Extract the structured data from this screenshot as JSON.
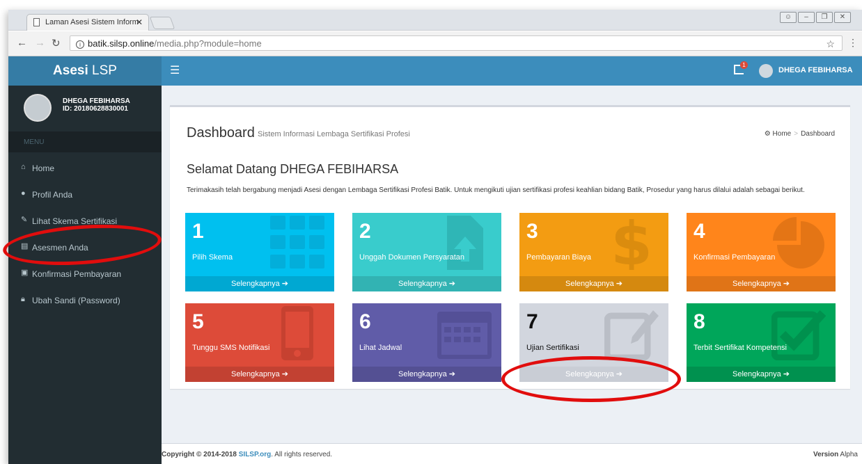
{
  "browser": {
    "tab_title": "Laman Asesi Sistem Inform",
    "url_host": "batik.silsp.online",
    "url_path": "/media.php?module=home"
  },
  "app": {
    "logo_bold": "Asesi",
    "logo_rest": " LSP",
    "notif_count": "1",
    "top_user": "DHEGA FEBIHARSA"
  },
  "sidebar": {
    "user_name": "DHEGA FEBIHARSA",
    "user_id": "ID: 20180628830001",
    "menu_header": "MENU",
    "items": [
      {
        "label": "Home",
        "icon": "home-icon"
      },
      {
        "label": "Profil Anda",
        "icon": "user-icon"
      },
      {
        "label": "Lihat Skema Sertifikasi",
        "icon": "edit-icon"
      },
      {
        "label": "Asesmen Anda",
        "icon": "file-icon"
      },
      {
        "label": "Konfirmasi Pembayaran",
        "icon": "money-icon"
      },
      {
        "label": "Ubah Sandi (Password)",
        "icon": "lock-icon"
      }
    ]
  },
  "main": {
    "title": "Dashboard",
    "subtitle": "Sistem Informasi Lembaga Sertifikasi Profesi",
    "breadcrumb": {
      "home": "Home",
      "sep": ">",
      "current": "Dashboard"
    },
    "welcome": "Selamat Datang DHEGA FEBIHARSA",
    "intro": "Terimakasih telah bergabung menjadi Asesi dengan Lembaga Sertifikasi Profesi Batik. Untuk mengikuti ujian sertifikasi profesi keahlian bidang Batik, Prosedur yang harus dilalui adalah sebagai berikut.",
    "tiles": [
      {
        "num": "1",
        "label": "Pilih Skema",
        "footer": "Selengkapnya ➔",
        "color": "#00c0ef",
        "icon": "grid-icon"
      },
      {
        "num": "2",
        "label": "Unggah Dokumen Persyaratan",
        "footer": "Selengkapnya ➔",
        "color": "#39cccc",
        "icon": "upload-file-icon"
      },
      {
        "num": "3",
        "label": "Pembayaran Biaya",
        "footer": "Selengkapnya ➔",
        "color": "#f39c12",
        "icon": "dollar-icon"
      },
      {
        "num": "4",
        "label": "Konfirmasi Pembayaran",
        "footer": "Selengkapnya ➔",
        "color": "#ff851b",
        "icon": "pie-chart-icon"
      },
      {
        "num": "5",
        "label": "Tunggu SMS Notifikasi",
        "footer": "Selengkapnya ➔",
        "color": "#dd4b39",
        "icon": "phone-icon"
      },
      {
        "num": "6",
        "label": "Lihat Jadwal",
        "footer": "Selengkapnya ➔",
        "color": "#605ca8",
        "icon": "calendar-icon"
      },
      {
        "num": "7",
        "label": "Ujian Sertifikasi",
        "footer": "Selengkapnya ➔",
        "color": "#d2d6de",
        "icon": "edit-square-icon"
      },
      {
        "num": "8",
        "label": "Terbit Sertifikat Kompetensi",
        "footer": "Selengkapnya ➔",
        "color": "#00a65a",
        "icon": "check-square-icon"
      }
    ]
  },
  "footer": {
    "copyright": "Copyright © 2014-2018",
    "link": "SILSP.org",
    "rights": ". All rights reserved.",
    "version_label": "Version",
    "version_value": " Alpha"
  },
  "colors": {
    "header": "#3c8dbc",
    "logo": "#357ca5",
    "sidebar": "#222d32",
    "annotation": "#e10d0d"
  }
}
